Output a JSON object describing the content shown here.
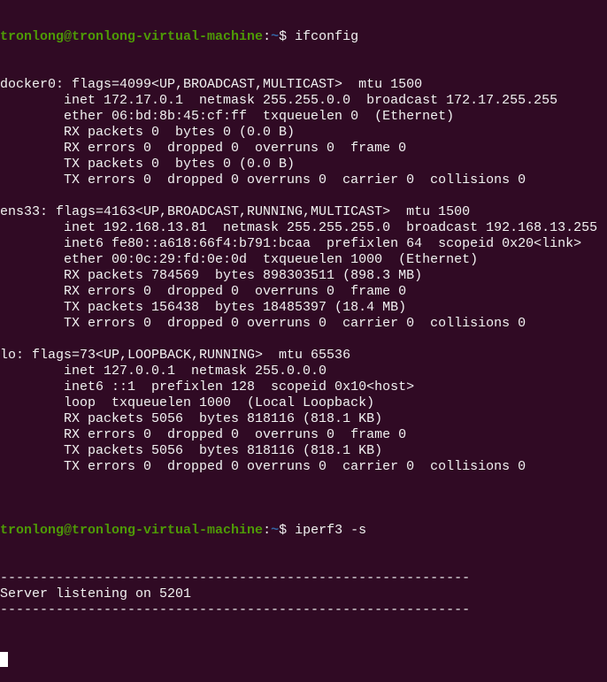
{
  "prompt": {
    "user_host": "tronlong@tronlong-virtual-machine",
    "sep": ":",
    "path": "~",
    "symbol": "$ "
  },
  "commands": [
    "ifconfig",
    "iperf3 -s"
  ],
  "ifconfig_output": [
    "docker0: flags=4099<UP,BROADCAST,MULTICAST>  mtu 1500",
    "        inet 172.17.0.1  netmask 255.255.0.0  broadcast 172.17.255.255",
    "        ether 06:bd:8b:45:cf:ff  txqueuelen 0  (Ethernet)",
    "        RX packets 0  bytes 0 (0.0 B)",
    "        RX errors 0  dropped 0  overruns 0  frame 0",
    "        TX packets 0  bytes 0 (0.0 B)",
    "        TX errors 0  dropped 0 overruns 0  carrier 0  collisions 0",
    "",
    "ens33: flags=4163<UP,BROADCAST,RUNNING,MULTICAST>  mtu 1500",
    "        inet 192.168.13.81  netmask 255.255.255.0  broadcast 192.168.13.255",
    "        inet6 fe80::a618:66f4:b791:bcaa  prefixlen 64  scopeid 0x20<link>",
    "        ether 00:0c:29:fd:0e:0d  txqueuelen 1000  (Ethernet)",
    "        RX packets 784569  bytes 898303511 (898.3 MB)",
    "        RX errors 0  dropped 0  overruns 0  frame 0",
    "        TX packets 156438  bytes 18485397 (18.4 MB)",
    "        TX errors 0  dropped 0 overruns 0  carrier 0  collisions 0",
    "",
    "lo: flags=73<UP,LOOPBACK,RUNNING>  mtu 65536",
    "        inet 127.0.0.1  netmask 255.0.0.0",
    "        inet6 ::1  prefixlen 128  scopeid 0x10<host>",
    "        loop  txqueuelen 1000  (Local Loopback)",
    "        RX packets 5056  bytes 818116 (818.1 KB)",
    "        RX errors 0  dropped 0  overruns 0  frame 0",
    "        TX packets 5056  bytes 818116 (818.1 KB)",
    "        TX errors 0  dropped 0 overruns 0  carrier 0  collisions 0",
    ""
  ],
  "iperf_output": [
    "-----------------------------------------------------------",
    "Server listening on 5201",
    "-----------------------------------------------------------"
  ],
  "colors": {
    "background": "#300a24",
    "text": "#f2f2f2",
    "user": "#4e9a06",
    "path": "#3465a4"
  }
}
